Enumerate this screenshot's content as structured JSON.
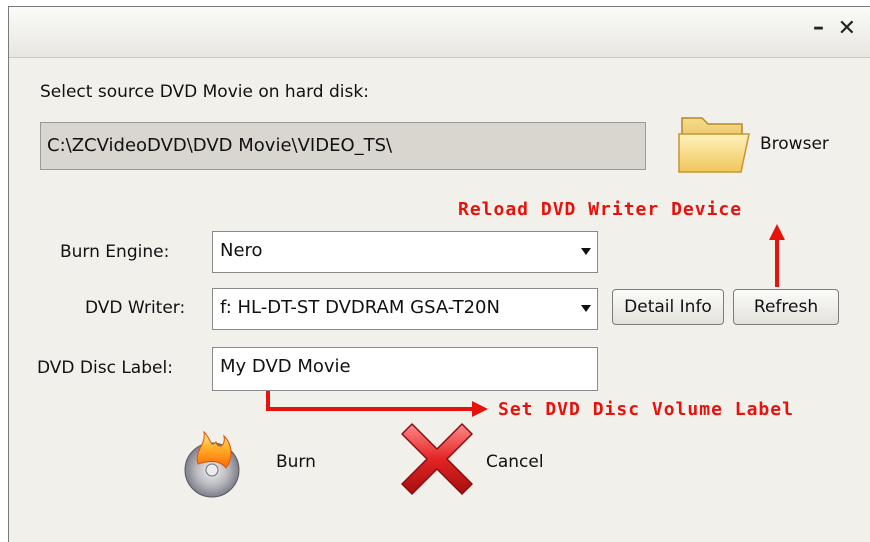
{
  "window": {
    "minimize_glyph": "–",
    "close_glyph": "✕"
  },
  "source": {
    "label": "Select source DVD Movie on hard disk:",
    "path": "C:\\ZCVideoDVD\\DVD Movie\\VIDEO_TS\\",
    "browse_label": "Browser",
    "browse_icon": "folder-icon"
  },
  "burn_engine": {
    "label": "Burn Engine:",
    "value": "Nero"
  },
  "dvd_writer": {
    "label": "DVD Writer:",
    "value": "f: HL-DT-ST DVDRAM GSA-T20N",
    "detail_label": "Detail Info",
    "refresh_label": "Refresh"
  },
  "disc_label": {
    "label": "DVD Disc Label:",
    "value": "My DVD Movie"
  },
  "actions": {
    "burn_label": "Burn",
    "burn_icon": "burning-disc-icon",
    "cancel_label": "Cancel",
    "cancel_icon": "red-x-icon"
  },
  "annotations": {
    "reload": "Reload DVD Writer Device",
    "volume": "Set DVD Disc Volume Label"
  },
  "colors": {
    "annotation": "#e8120c",
    "window_bg": "#f1f0eb"
  }
}
